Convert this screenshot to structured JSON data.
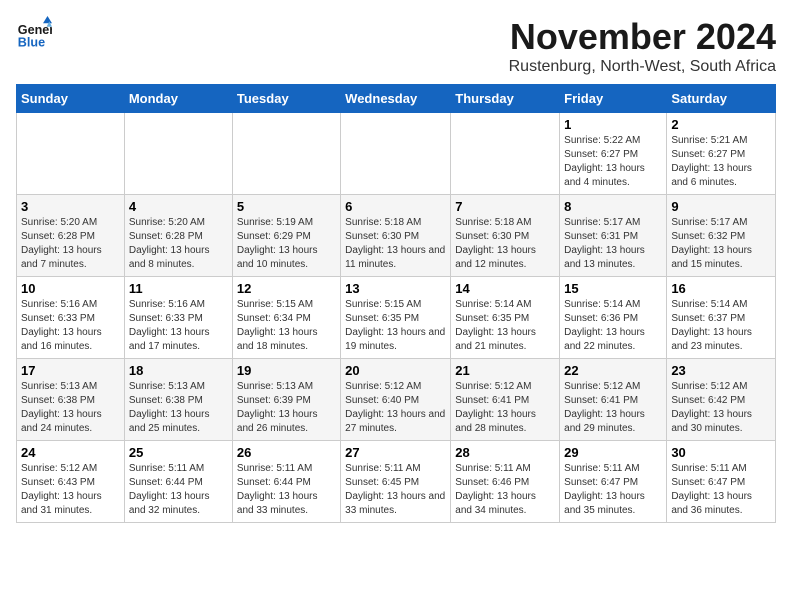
{
  "header": {
    "logo_line1": "General",
    "logo_line2": "Blue",
    "month_title": "November 2024",
    "subtitle": "Rustenburg, North-West, South Africa"
  },
  "days_of_week": [
    "Sunday",
    "Monday",
    "Tuesday",
    "Wednesday",
    "Thursday",
    "Friday",
    "Saturday"
  ],
  "weeks": [
    [
      {
        "day": "",
        "info": ""
      },
      {
        "day": "",
        "info": ""
      },
      {
        "day": "",
        "info": ""
      },
      {
        "day": "",
        "info": ""
      },
      {
        "day": "",
        "info": ""
      },
      {
        "day": "1",
        "info": "Sunrise: 5:22 AM\nSunset: 6:27 PM\nDaylight: 13 hours and 4 minutes."
      },
      {
        "day": "2",
        "info": "Sunrise: 5:21 AM\nSunset: 6:27 PM\nDaylight: 13 hours and 6 minutes."
      }
    ],
    [
      {
        "day": "3",
        "info": "Sunrise: 5:20 AM\nSunset: 6:28 PM\nDaylight: 13 hours and 7 minutes."
      },
      {
        "day": "4",
        "info": "Sunrise: 5:20 AM\nSunset: 6:28 PM\nDaylight: 13 hours and 8 minutes."
      },
      {
        "day": "5",
        "info": "Sunrise: 5:19 AM\nSunset: 6:29 PM\nDaylight: 13 hours and 10 minutes."
      },
      {
        "day": "6",
        "info": "Sunrise: 5:18 AM\nSunset: 6:30 PM\nDaylight: 13 hours and 11 minutes."
      },
      {
        "day": "7",
        "info": "Sunrise: 5:18 AM\nSunset: 6:30 PM\nDaylight: 13 hours and 12 minutes."
      },
      {
        "day": "8",
        "info": "Sunrise: 5:17 AM\nSunset: 6:31 PM\nDaylight: 13 hours and 13 minutes."
      },
      {
        "day": "9",
        "info": "Sunrise: 5:17 AM\nSunset: 6:32 PM\nDaylight: 13 hours and 15 minutes."
      }
    ],
    [
      {
        "day": "10",
        "info": "Sunrise: 5:16 AM\nSunset: 6:33 PM\nDaylight: 13 hours and 16 minutes."
      },
      {
        "day": "11",
        "info": "Sunrise: 5:16 AM\nSunset: 6:33 PM\nDaylight: 13 hours and 17 minutes."
      },
      {
        "day": "12",
        "info": "Sunrise: 5:15 AM\nSunset: 6:34 PM\nDaylight: 13 hours and 18 minutes."
      },
      {
        "day": "13",
        "info": "Sunrise: 5:15 AM\nSunset: 6:35 PM\nDaylight: 13 hours and 19 minutes."
      },
      {
        "day": "14",
        "info": "Sunrise: 5:14 AM\nSunset: 6:35 PM\nDaylight: 13 hours and 21 minutes."
      },
      {
        "day": "15",
        "info": "Sunrise: 5:14 AM\nSunset: 6:36 PM\nDaylight: 13 hours and 22 minutes."
      },
      {
        "day": "16",
        "info": "Sunrise: 5:14 AM\nSunset: 6:37 PM\nDaylight: 13 hours and 23 minutes."
      }
    ],
    [
      {
        "day": "17",
        "info": "Sunrise: 5:13 AM\nSunset: 6:38 PM\nDaylight: 13 hours and 24 minutes."
      },
      {
        "day": "18",
        "info": "Sunrise: 5:13 AM\nSunset: 6:38 PM\nDaylight: 13 hours and 25 minutes."
      },
      {
        "day": "19",
        "info": "Sunrise: 5:13 AM\nSunset: 6:39 PM\nDaylight: 13 hours and 26 minutes."
      },
      {
        "day": "20",
        "info": "Sunrise: 5:12 AM\nSunset: 6:40 PM\nDaylight: 13 hours and 27 minutes."
      },
      {
        "day": "21",
        "info": "Sunrise: 5:12 AM\nSunset: 6:41 PM\nDaylight: 13 hours and 28 minutes."
      },
      {
        "day": "22",
        "info": "Sunrise: 5:12 AM\nSunset: 6:41 PM\nDaylight: 13 hours and 29 minutes."
      },
      {
        "day": "23",
        "info": "Sunrise: 5:12 AM\nSunset: 6:42 PM\nDaylight: 13 hours and 30 minutes."
      }
    ],
    [
      {
        "day": "24",
        "info": "Sunrise: 5:12 AM\nSunset: 6:43 PM\nDaylight: 13 hours and 31 minutes."
      },
      {
        "day": "25",
        "info": "Sunrise: 5:11 AM\nSunset: 6:44 PM\nDaylight: 13 hours and 32 minutes."
      },
      {
        "day": "26",
        "info": "Sunrise: 5:11 AM\nSunset: 6:44 PM\nDaylight: 13 hours and 33 minutes."
      },
      {
        "day": "27",
        "info": "Sunrise: 5:11 AM\nSunset: 6:45 PM\nDaylight: 13 hours and 33 minutes."
      },
      {
        "day": "28",
        "info": "Sunrise: 5:11 AM\nSunset: 6:46 PM\nDaylight: 13 hours and 34 minutes."
      },
      {
        "day": "29",
        "info": "Sunrise: 5:11 AM\nSunset: 6:47 PM\nDaylight: 13 hours and 35 minutes."
      },
      {
        "day": "30",
        "info": "Sunrise: 5:11 AM\nSunset: 6:47 PM\nDaylight: 13 hours and 36 minutes."
      }
    ]
  ]
}
